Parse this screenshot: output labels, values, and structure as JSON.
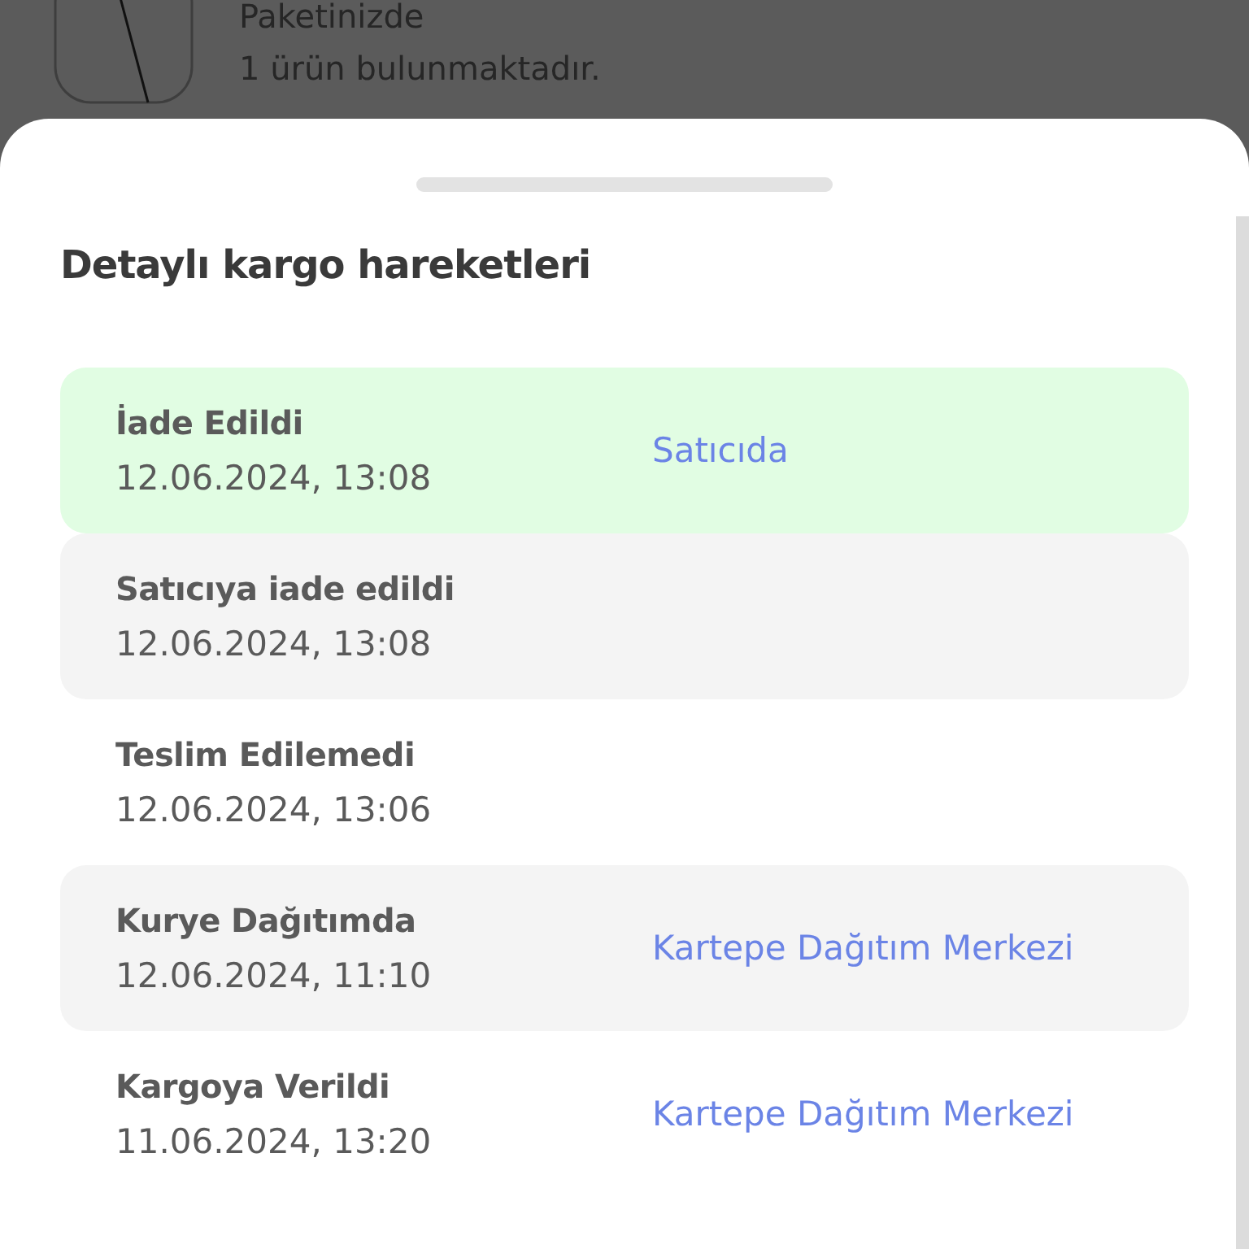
{
  "background_package": {
    "line_1": "Paketinizde",
    "line_2": "1 ürün bulunmaktadır."
  },
  "sheet": {
    "title": "Detaylı kargo hareketleri",
    "events": [
      {
        "kind": "current",
        "status": "İade Edildi",
        "datetime": "12.06.2024, 13:08",
        "location": "Satıcıda"
      },
      {
        "kind": "shaded",
        "status": "Satıcıya iade edildi",
        "datetime": "12.06.2024, 13:08"
      },
      {
        "kind": "plain",
        "status": "Teslim Edilemedi",
        "datetime": "12.06.2024, 13:06"
      },
      {
        "kind": "shaded",
        "status": "Kurye Dağıtımda",
        "datetime": "12.06.2024, 11:10",
        "location": "Kartepe Dağıtım Merkezi"
      },
      {
        "kind": "plain",
        "status": "Kargoya Verildi",
        "datetime": "11.06.2024, 13:20",
        "location": "Kartepe Dağıtım Merkezi"
      }
    ]
  }
}
